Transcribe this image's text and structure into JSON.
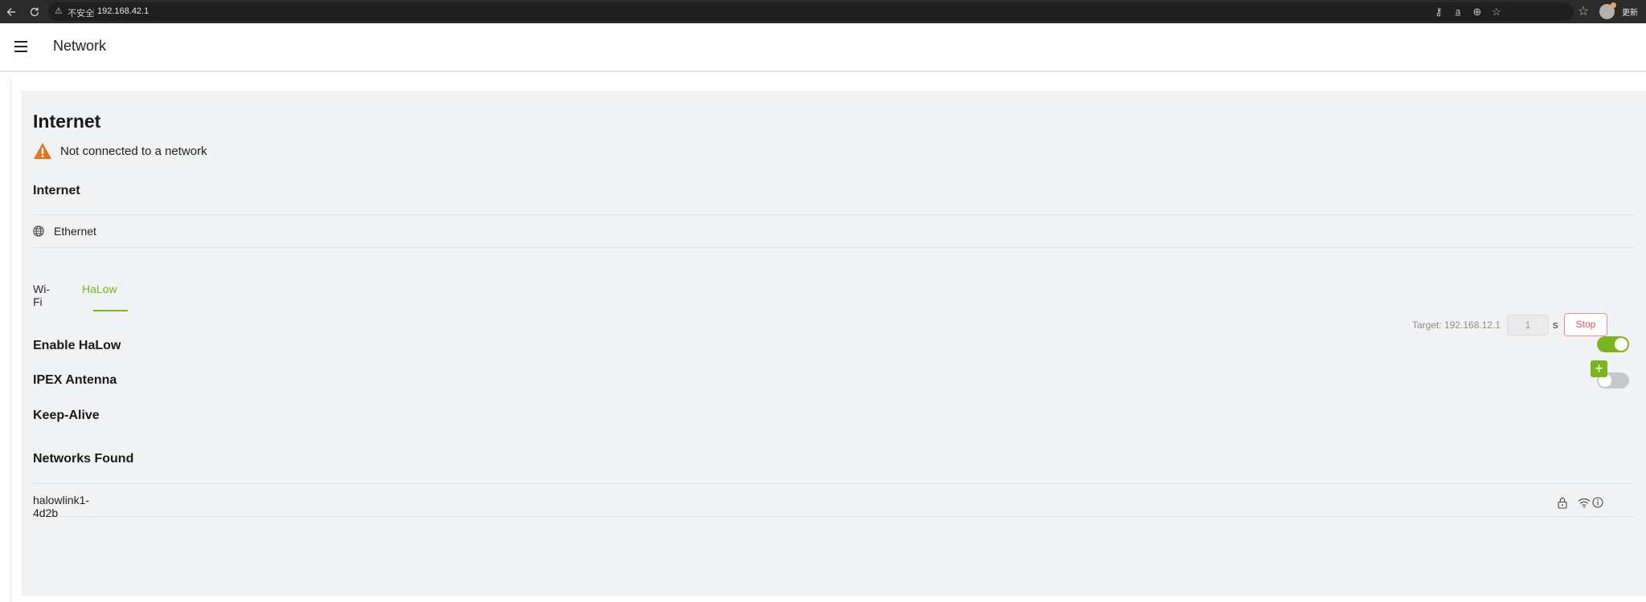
{
  "browser": {
    "security_label": "不安全",
    "url": "192.168.42.1",
    "update_label": "更新",
    "icons": [
      "back-icon",
      "reload-icon",
      "key-icon",
      "translate-icon",
      "zoom-icon",
      "star-icon",
      "extensions-icon"
    ]
  },
  "header": {
    "title": "Network"
  },
  "page": {
    "title": "Internet",
    "status_text": "Not connected to a network"
  },
  "internet": {
    "heading": "Internet",
    "items": [
      {
        "label": "Ethernet",
        "icon": "globe-icon"
      }
    ]
  },
  "tabs": [
    {
      "label": "Wi-Fi",
      "active": false
    },
    {
      "label": "HaLow",
      "active": true
    }
  ],
  "halow": {
    "enable_label": "Enable HaLow",
    "enable_on": true,
    "ipex_label": "IPEX Antenna",
    "ipex_on": false,
    "keepalive_label": "Keep-Alive",
    "keepalive_target": "Target: 192.168.12.1",
    "keepalive_interval": "1",
    "keepalive_unit": "s",
    "stop_label": "Stop"
  },
  "networks": {
    "heading": "Networks Found",
    "add_label": "+",
    "items": [
      {
        "ssid": "halowlink1-4d2b",
        "icons": [
          "lock-icon",
          "wifi-signal-icon",
          "info-icon"
        ]
      }
    ]
  },
  "colors": {
    "accent": "#7ab51d",
    "warning": "#e8731f",
    "danger": "#e05454",
    "card_bg": "#f1f2f4"
  }
}
